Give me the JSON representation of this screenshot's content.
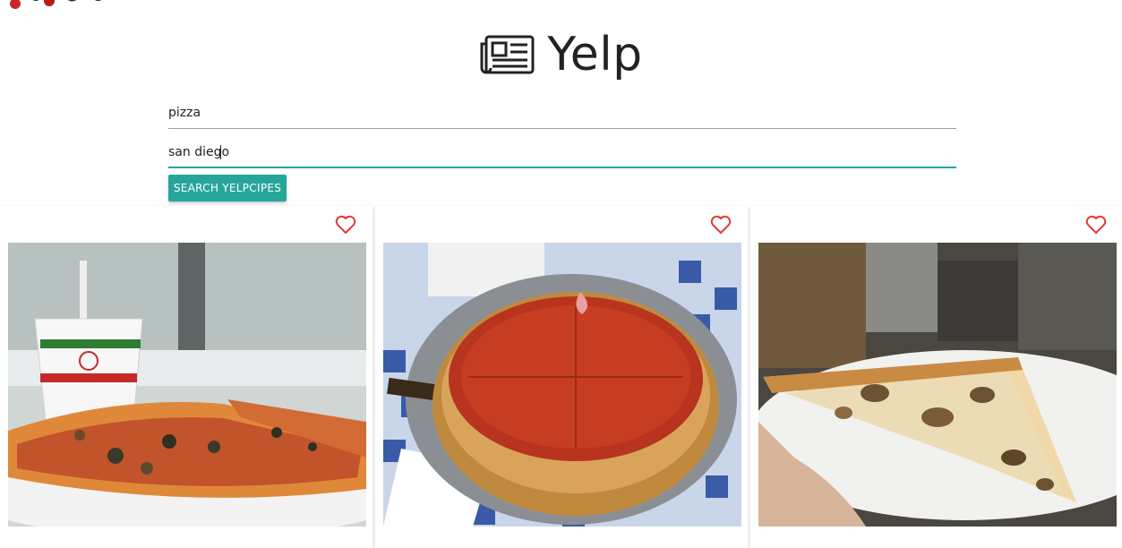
{
  "header": {
    "title": "Yelp",
    "icon": "newspaper-icon"
  },
  "search": {
    "term_value": "pizza",
    "location_value": "san diego",
    "button_label": "Search Yelpcipes"
  },
  "colors": {
    "accent": "#26a69a",
    "heart": "#e53935",
    "text": "#222222"
  },
  "cards": [
    {
      "photo": "pizza-slices-with-bronx-cup-photo",
      "favorite_icon": "heart-outline-icon"
    },
    {
      "photo": "deep-dish-pizza-photo",
      "favorite_icon": "heart-outline-icon"
    },
    {
      "photo": "mushroom-pizza-slice-photo",
      "favorite_icon": "heart-outline-icon"
    }
  ]
}
